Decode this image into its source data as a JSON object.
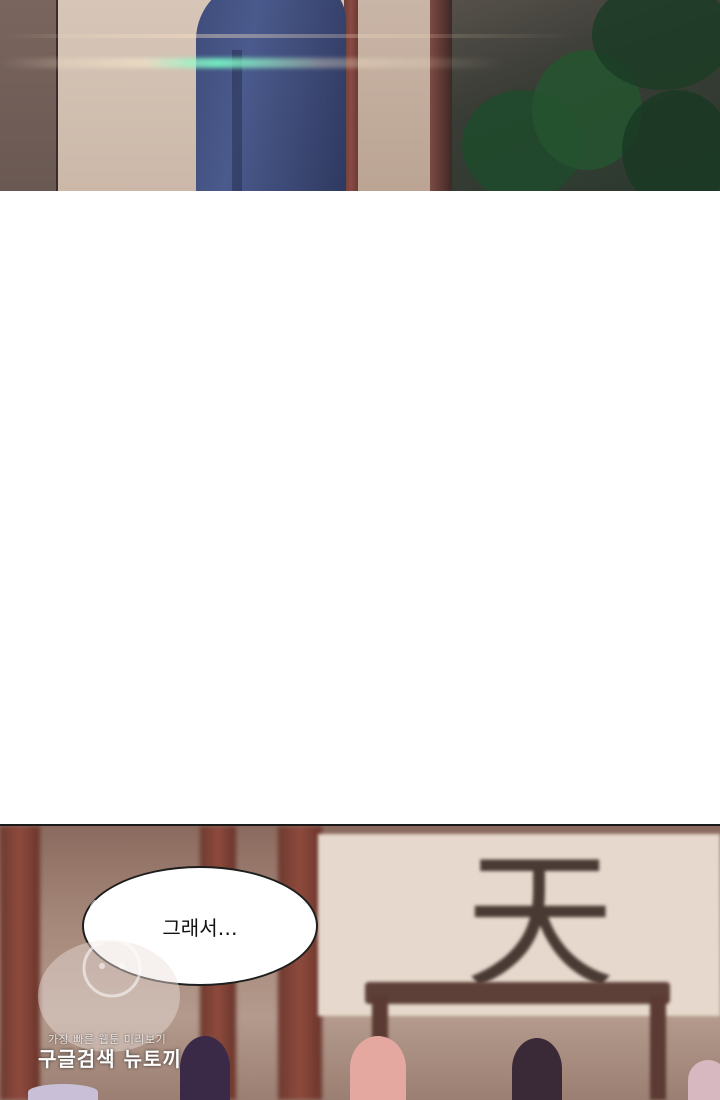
{
  "panels": {
    "bottom": {
      "speech_bubble": {
        "text": "그래서…"
      },
      "sign": {
        "character": "天"
      }
    }
  },
  "watermark": {
    "line1": "가장 빠른 웹툰 미리보기",
    "line2": "구글검색 뉴토끼"
  },
  "colors": {
    "figure_robe": "#4a5a8c",
    "pillar": "#8e4a3c",
    "bubble_border": "#1e1e1e"
  }
}
